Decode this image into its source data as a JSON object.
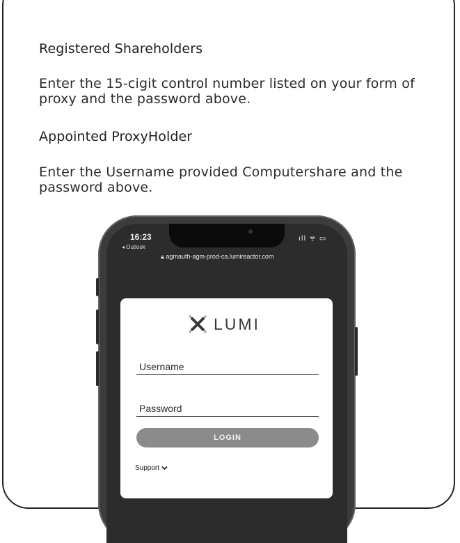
{
  "sections": {
    "registered": {
      "heading": "Registered Shareholders",
      "body": "Enter the 15-cigit control number listed on your form of proxy and the password above."
    },
    "appointed": {
      "heading": "Appointed ProxyHolder",
      "body": "Enter the Username provided Computershare and the password above."
    }
  },
  "phone": {
    "status": {
      "time": "16:23",
      "back_app": "◂ Outlook",
      "icons": "ıll ᯤ ▭"
    },
    "url": "agmauth-agm-prod-ca.lumireactor.com",
    "login": {
      "brand": "LUMI",
      "username_label": "Username",
      "password_label": "Password",
      "login_button": "LOGIN",
      "support_label": "Support"
    }
  },
  "colors": {
    "card_border": "#222222",
    "phone_body": "#3c3c3c",
    "login_button": "#8b8b8b"
  }
}
